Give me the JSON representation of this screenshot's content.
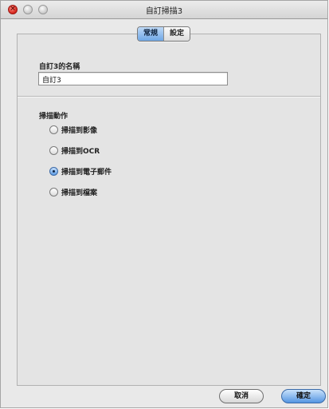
{
  "window": {
    "title": "自訂掃描3"
  },
  "tabs": [
    {
      "label": "常規",
      "active": true
    },
    {
      "label": "設定",
      "active": false
    }
  ],
  "name_section": {
    "label": "自訂3的名稱",
    "value": "自訂3"
  },
  "action_section": {
    "label": "掃描動作",
    "options": [
      {
        "label": "掃描到影像",
        "checked": false
      },
      {
        "label": "掃描到OCR",
        "checked": false
      },
      {
        "label": "掃描到電子郵件",
        "checked": true
      },
      {
        "label": "掃描到檔案",
        "checked": false
      }
    ]
  },
  "buttons": {
    "cancel": "取消",
    "ok": "確定"
  },
  "icons": {
    "close": "close-icon",
    "minimize": "minimize-icon",
    "zoom": "zoom-icon"
  },
  "colors": {
    "accent": "#5d9be3",
    "close": "#d4221a"
  }
}
